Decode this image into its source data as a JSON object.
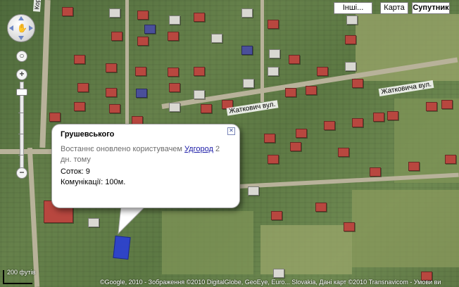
{
  "map": {
    "type": "satellite",
    "streets": [
      "Коритна",
      "Жаткович вул.",
      "Жатковича вул."
    ],
    "polygon_color": "#2a3fd6"
  },
  "maptype": {
    "other_label": "Інші...",
    "map_label": "Карта",
    "satellite_label": "Супутник"
  },
  "nav": {
    "zoom_in": "+",
    "zoom_out": "−"
  },
  "info_window": {
    "title": "Грушевського",
    "updated_prefix": "Востаннє оновлено користувачем",
    "updated_user": "Удгород",
    "updated_suffix": "2 дн. тому",
    "line1": "Соток: 9",
    "line2": "Комунікації: 100м.",
    "close_icon": "close-icon"
  },
  "footer": {
    "scale": "200 футів",
    "attribution": "©Google, 2010 - Зображення ©2010 DigitalGlobe, GeoEye, Euro... Slovakia, Дані карт ©2010 Transnavicom - Умови ви"
  }
}
